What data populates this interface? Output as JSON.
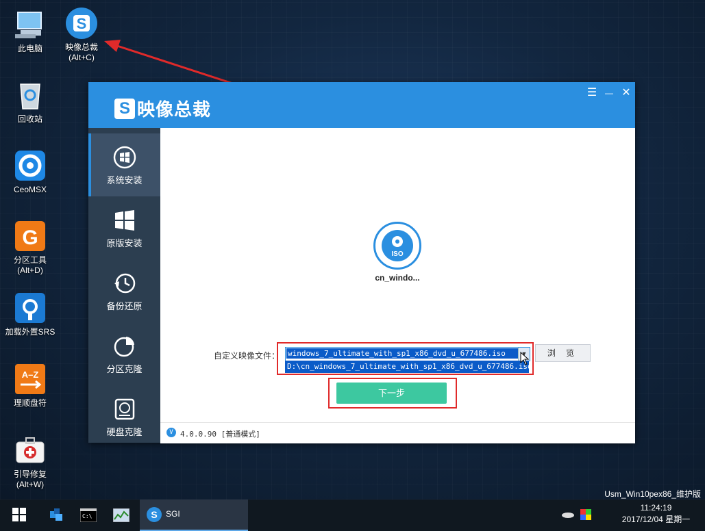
{
  "desktop": {
    "icons": [
      {
        "label": "此电脑",
        "sub": ""
      },
      {
        "label": "映像总裁",
        "sub": "(Alt+C)"
      },
      {
        "label": "回收站",
        "sub": ""
      },
      {
        "label": "CeoMSX",
        "sub": ""
      },
      {
        "label": "分区工具",
        "sub": "(Alt+D)"
      },
      {
        "label": "加载外置SRS",
        "sub": ""
      },
      {
        "label": "理顺盘符",
        "sub": ""
      },
      {
        "label": "引导修复",
        "sub": "(Alt+W)"
      }
    ],
    "app_logo_letter": "S",
    "pe_label": "Usm_Win10pex86_维护版"
  },
  "window": {
    "title": "映像总裁",
    "logo_letter": "S",
    "controls": {
      "menu": "☰",
      "minimize": "—",
      "close": "✕"
    },
    "sidebar": [
      {
        "label": "系统安装",
        "icon": "windows-logo-icon",
        "active": true
      },
      {
        "label": "原版安装",
        "icon": "windows-tiles-icon",
        "active": false
      },
      {
        "label": "备份还原",
        "icon": "clock-backup-icon",
        "active": false
      },
      {
        "label": "分区克隆",
        "icon": "pie-partition-icon",
        "active": false
      },
      {
        "label": "硬盘克隆",
        "icon": "hard-disk-icon",
        "active": false
      }
    ],
    "iso": {
      "badge": "ISO",
      "name": "cn_windo..."
    },
    "image_file": {
      "label": "自定义映像文件：",
      "selected": "windows_7_ultimate_with_sp1_x86_dvd_u_677486.iso",
      "option": "D:\\cn_windows_7_ultimate_with_sp1_x86_dvd_u_677486.iso"
    },
    "browse_label": "浏 览",
    "next_label": "下一步",
    "status": {
      "version_badge": "V",
      "text": "4.0.0.90 [普通模式]"
    }
  },
  "taskbar": {
    "active_app": "SGI",
    "time": "11:24:19",
    "date": "2017/12/04 星期一"
  },
  "colors": {
    "accent": "#2b8fe0",
    "sidebar": "#2c3e50",
    "next_button": "#3dc8a0",
    "highlight": "#e02a2a"
  }
}
